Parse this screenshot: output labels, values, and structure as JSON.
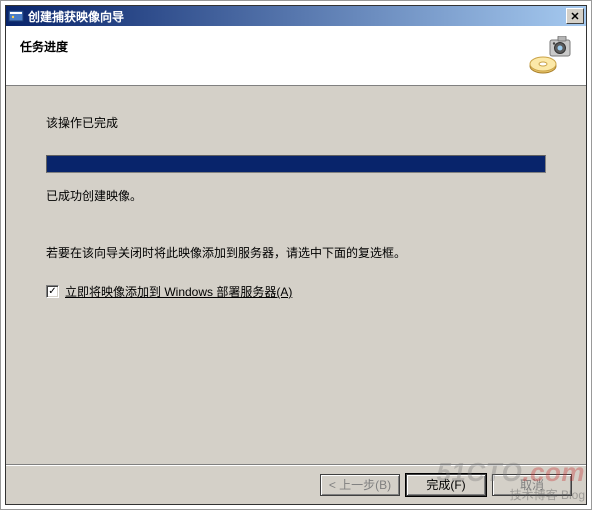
{
  "titlebar": {
    "title": "创建捕获映像向导",
    "close_label": "✕"
  },
  "header": {
    "title": "任务进度"
  },
  "content": {
    "status": "该操作已完成",
    "success": "已成功创建映像。",
    "hint": "若要在该向导关闭时将此映像添加到服务器，请选中下面的复选框。",
    "checkbox_checked": "✓",
    "checkbox_label": "立即将映像添加到 Windows 部署服务器(A)"
  },
  "buttons": {
    "back": "< 上一步(B)",
    "finish": "完成(F)",
    "cancel": "取消"
  },
  "watermark": {
    "brand_prefix": "51CTO",
    "brand_suffix": ".com",
    "sub": "技术博客  Blog"
  }
}
